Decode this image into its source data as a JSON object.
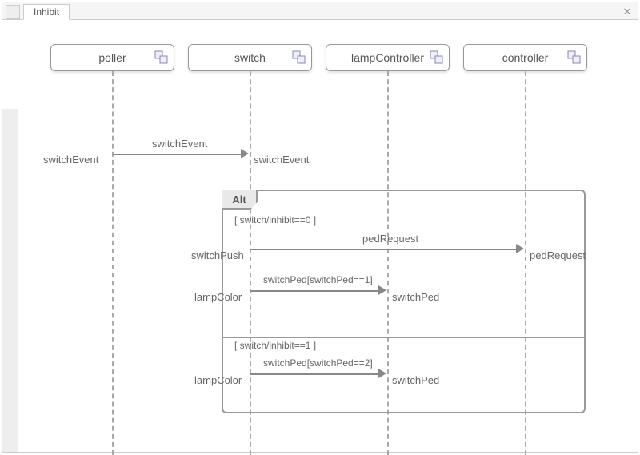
{
  "tab": {
    "active_label": "Inhibit"
  },
  "lifelines": {
    "poller": "poller",
    "switch": "switch",
    "lampController": "lampController",
    "controller": "controller"
  },
  "messages": {
    "switchEvent_top": "switchEvent",
    "switchEvent_left": "switchEvent",
    "switchEvent_right": "switchEvent",
    "pedRequest_top": "pedRequest",
    "switchPush_left": "switchPush",
    "pedRequest_right": "pedRequest",
    "switchPed1_top": "switchPed[switchPed==1]",
    "lampColor_left1": "lampColor",
    "switchPed_right1": "switchPed",
    "switchPed2_top": "switchPed[switchPed==2]",
    "lampColor_left2": "lampColor",
    "switchPed_right2": "switchPed"
  },
  "alt": {
    "label": "Alt",
    "guard1": "[ switch/inhibit==0 ]",
    "guard2": "[ switch/inhibit==1 ]"
  },
  "icons": {
    "lifeline_icon": "lifeline-object-icon",
    "close_icon": "close-icon"
  }
}
